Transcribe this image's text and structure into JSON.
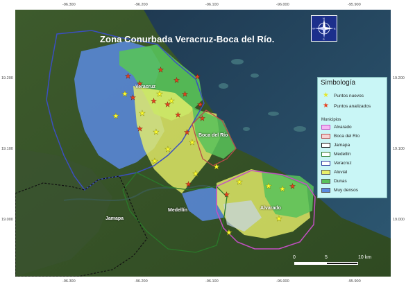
{
  "title": "Zona Conurbada Veracruz-Boca del Río.",
  "coordinates": {
    "top": [
      "-96.300",
      "-96.200",
      "-96.100",
      "-96.000",
      "-95.900"
    ],
    "bottom": [
      "-96.300",
      "-96.200",
      "-96.100",
      "-96.000",
      "-95.900"
    ],
    "left": [
      "19.200",
      "19.100",
      "19.000"
    ],
    "right": [
      "19.200",
      "19.100",
      "19.000"
    ]
  },
  "map_labels": {
    "veracruz": "Veracruz",
    "boca_del_rio": "Boca del Río",
    "jamapa": "Jamapa",
    "medellin": "Medellín",
    "alvarado": "Alvarado"
  },
  "legend": {
    "title": "Simbología",
    "symbols": [
      {
        "label": "Puntos nuevos",
        "glyph": "★",
        "color": "#ffff33"
      },
      {
        "label": "Puntos analizados",
        "glyph": "★",
        "color": "#e8401f"
      }
    ],
    "subtitle": "Municipios",
    "municipios": [
      {
        "label": "Alvarado",
        "fill": "#f5b8f5",
        "stroke": "#c44fc4"
      },
      {
        "label": "Boca del Río",
        "fill": "#f6d2d2",
        "stroke": "#b74a4a"
      },
      {
        "label": "Jamapa",
        "fill": "#ffffff",
        "stroke": "#111111"
      },
      {
        "label": "Medellín",
        "fill": "#ffffff",
        "stroke": "#2a7a2a"
      },
      {
        "label": "Veracruz",
        "fill": "#ffffff",
        "stroke": "#2b3a9c"
      },
      {
        "label": "Aluvial",
        "fill": "#e8f06a",
        "stroke": "#666666"
      },
      {
        "label": "Dunas",
        "fill": "#58c25a",
        "stroke": "#666666"
      },
      {
        "label": "Muy densos",
        "fill": "#5a8ae0",
        "stroke": "#666666"
      }
    ]
  },
  "compass": {
    "icon": "compass-rose-icon",
    "n": "N",
    "s": "S",
    "e": "E",
    "w": "W"
  },
  "scale_bar": {
    "ticks": [
      "0",
      "5",
      "10 km"
    ]
  }
}
